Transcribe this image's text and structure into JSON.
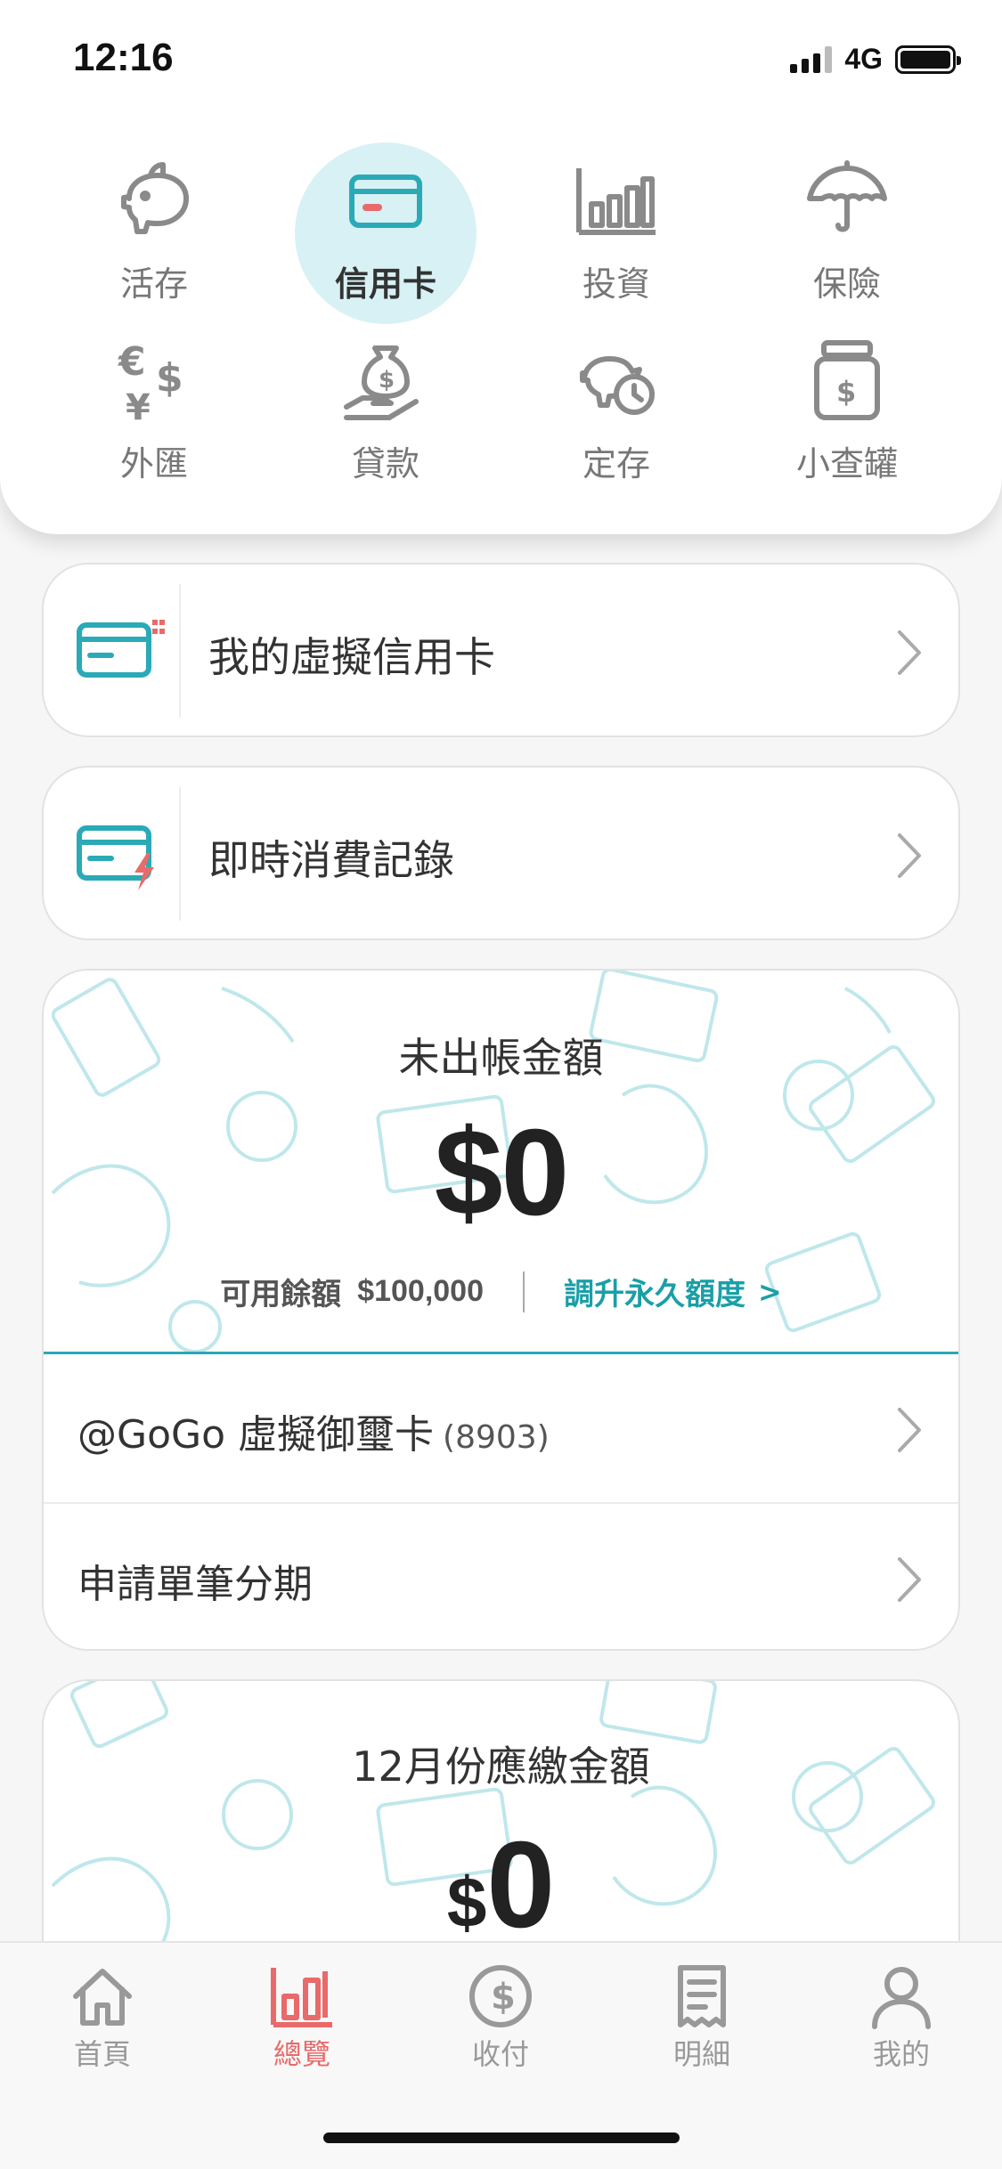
{
  "status_bar": {
    "time": "12:16",
    "network": "4G"
  },
  "categories": [
    {
      "label": "活存",
      "icon": "piggy-bank-icon",
      "active": false
    },
    {
      "label": "信用卡",
      "icon": "credit-card-icon",
      "active": true
    },
    {
      "label": "投資",
      "icon": "bar-chart-icon",
      "active": false
    },
    {
      "label": "保險",
      "icon": "umbrella-icon",
      "active": false
    },
    {
      "label": "外匯",
      "icon": "currency-exchange-icon",
      "active": false
    },
    {
      "label": "貸款",
      "icon": "money-bag-hand-icon",
      "active": false
    },
    {
      "label": "定存",
      "icon": "piggy-clock-icon",
      "active": false
    },
    {
      "label": "小查罐",
      "icon": "savings-jar-icon",
      "active": false
    }
  ],
  "links": {
    "virtual_card": "我的虛擬信用卡",
    "realtime_records": "即時消費記錄"
  },
  "balance_card": {
    "title": "未出帳金額",
    "amount": "$0",
    "available_label": "可用餘額",
    "available_value": "$100,000",
    "upgrade_link": "調升永久額度",
    "upgrade_chevron": ">",
    "card_row": {
      "name": "@GoGo 虛擬御璽卡",
      "number": "(8903)"
    },
    "installment_row": "申請單筆分期"
  },
  "due_card": {
    "title": "12月份應繳金額",
    "currency": "$",
    "amount": "0"
  },
  "tabs": [
    {
      "label": "首頁",
      "icon": "home-icon",
      "active": false
    },
    {
      "label": "總覽",
      "icon": "overview-chart-icon",
      "active": true
    },
    {
      "label": "收付",
      "icon": "dollar-circle-icon",
      "active": false
    },
    {
      "label": "明細",
      "icon": "receipt-icon",
      "active": false
    },
    {
      "label": "我的",
      "icon": "user-icon",
      "active": false
    }
  ],
  "colors": {
    "accent": "#1a9fa8",
    "active_tab": "#e86a6a",
    "bubble": "#d8f1f4"
  }
}
